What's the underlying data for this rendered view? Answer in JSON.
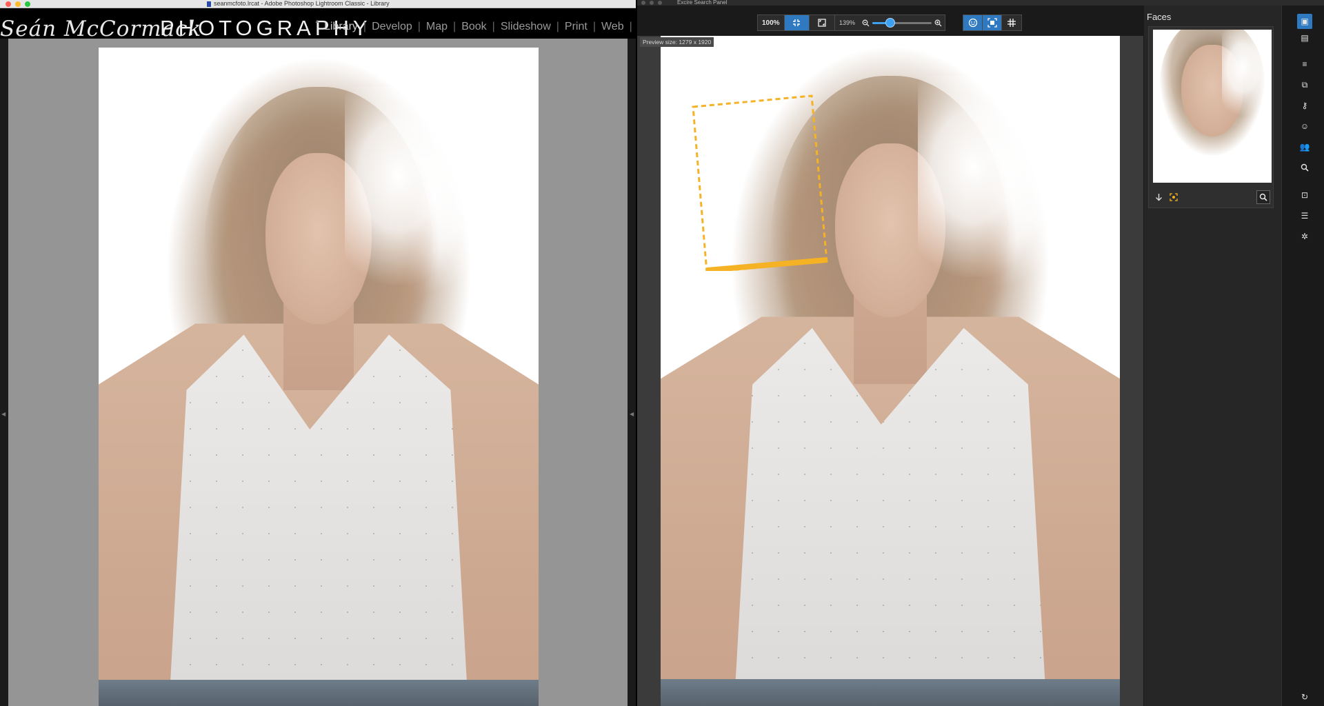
{
  "lightroom": {
    "window_title": "seanmcfoto.lrcat - Adobe Photoshop Lightroom Classic - Library",
    "identity_script": "Seán McCormack",
    "identity_caps": "PHOTOGRAPHY",
    "modules": [
      "Library",
      "Develop",
      "Map",
      "Book",
      "Slideshow",
      "Print",
      "Web"
    ],
    "active_module": "Library",
    "cloud_icon": "cloud-sync-icon"
  },
  "excire": {
    "window_title": "Excire Search Panel",
    "toolbar": {
      "zoom_100_label": "100%",
      "fit_icon": "fit-to-window-icon",
      "fill_icon": "fill-frame-icon",
      "zoom_value": "139%",
      "zoom_slider_fraction": 0.26,
      "zoom_out_icon": "zoom-out-icon",
      "zoom_in_icon": "zoom-in-icon",
      "face_detect_icon": "face-detect-icon",
      "face_frame_icon": "face-frame-icon",
      "grid_icon": "grid-icon"
    },
    "preview_size": "Preview size: 1279 x 1920",
    "face_box_color": "#F5B224",
    "accent_color": "#2E79C0",
    "faces_panel": {
      "heading": "Faces",
      "download_icon": "arrow-down-icon",
      "locate_icon": "face-locate-icon",
      "search_icon": "search-icon"
    },
    "sidebar_icons": [
      "image-icon",
      "stacked-images-icon",
      "edit-list-icon",
      "copy-icon",
      "keyword-icon",
      "face-icon",
      "people-icon",
      "search-icon",
      "collection-icon",
      "sort-icon",
      "settings-sparkle-icon",
      "refresh-icon"
    ]
  }
}
